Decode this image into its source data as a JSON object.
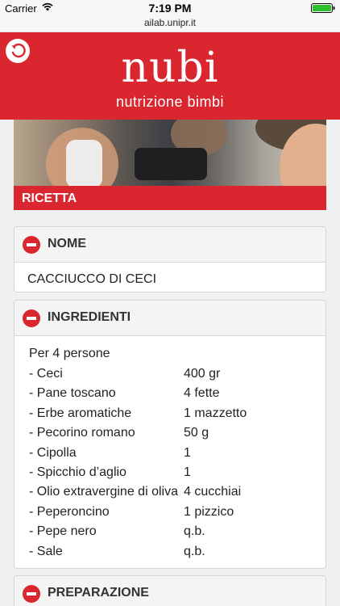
{
  "status_bar": {
    "carrier": "Carrier",
    "time": "7:19 PM",
    "url": "ailab.unipr.it"
  },
  "header": {
    "back_icon": "back-arrow-icon",
    "logo_title": "nubi",
    "logo_subtitle": "nutrizione bimbi",
    "brand_color": "#d9262f"
  },
  "section_title": "RICETTA",
  "nome": {
    "title": "NOME",
    "value": "CACCIUCCO DI CECI"
  },
  "ingredienti": {
    "title": "INGREDIENTI",
    "intro": "Per 4 persone",
    "items": [
      {
        "name": "- Ceci",
        "qty": "400 gr"
      },
      {
        "name": "- Pane toscano",
        "qty": "4 fette"
      },
      {
        "name": "- Erbe aromatiche",
        "qty": "1 mazzetto"
      },
      {
        "name": "- Pecorino romano",
        "qty": "50 g"
      },
      {
        "name": "- Cipolla",
        "qty": "1"
      },
      {
        "name": "- Spicchio d’aglio",
        "qty": "1"
      },
      {
        "name": "- Olio extravergine di oliva",
        "qty": "4 cucchiai"
      },
      {
        "name": "- Peperoncino",
        "qty": "1 pizzico"
      },
      {
        "name": "- Pepe nero",
        "qty": "q.b."
      },
      {
        "name": "- Sale",
        "qty": "q.b."
      }
    ]
  },
  "preparazione": {
    "title": "PREPARAZIONE"
  }
}
